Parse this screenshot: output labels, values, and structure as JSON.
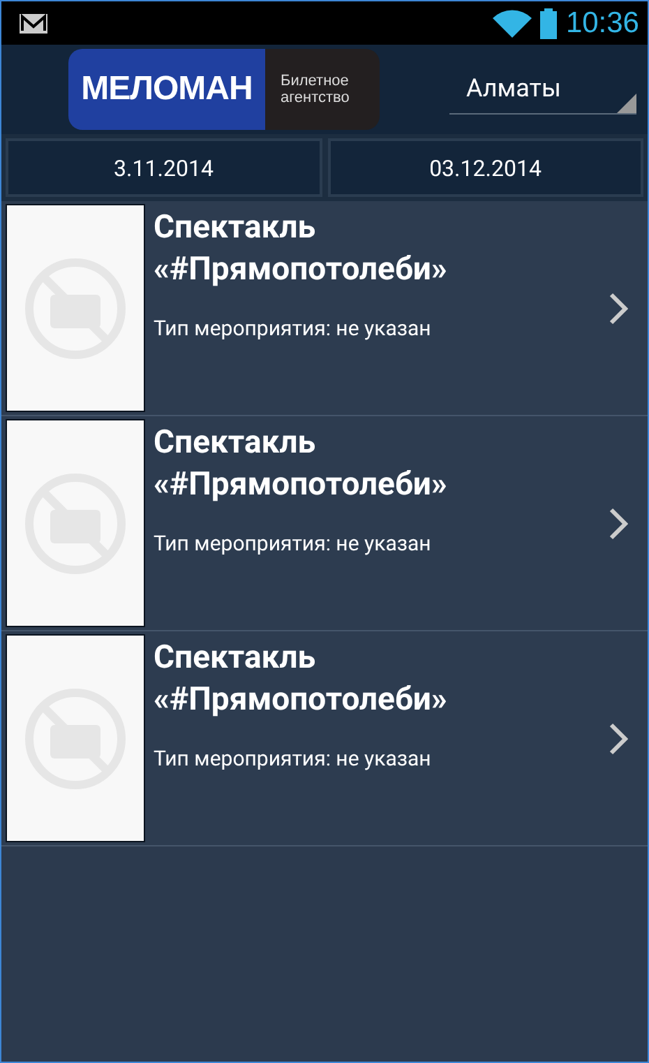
{
  "status_bar": {
    "time": "10:36"
  },
  "header": {
    "logo_brand": "МЕЛОМАН",
    "logo_tagline": [
      "Билетное",
      "агентство"
    ],
    "city": "Алматы"
  },
  "date_range": {
    "from": "3.11.2014",
    "to": "03.12.2014"
  },
  "events": [
    {
      "title": "Спектакль «#Прямопотолеби»",
      "type_line": "Тип мероприятия: не указан"
    },
    {
      "title": "Спектакль «#Прямопотолеби»",
      "type_line": "Тип мероприятия: не указан"
    },
    {
      "title": "Спектакль «#Прямопотолеби»",
      "type_line": "Тип мероприятия: не указан"
    }
  ]
}
